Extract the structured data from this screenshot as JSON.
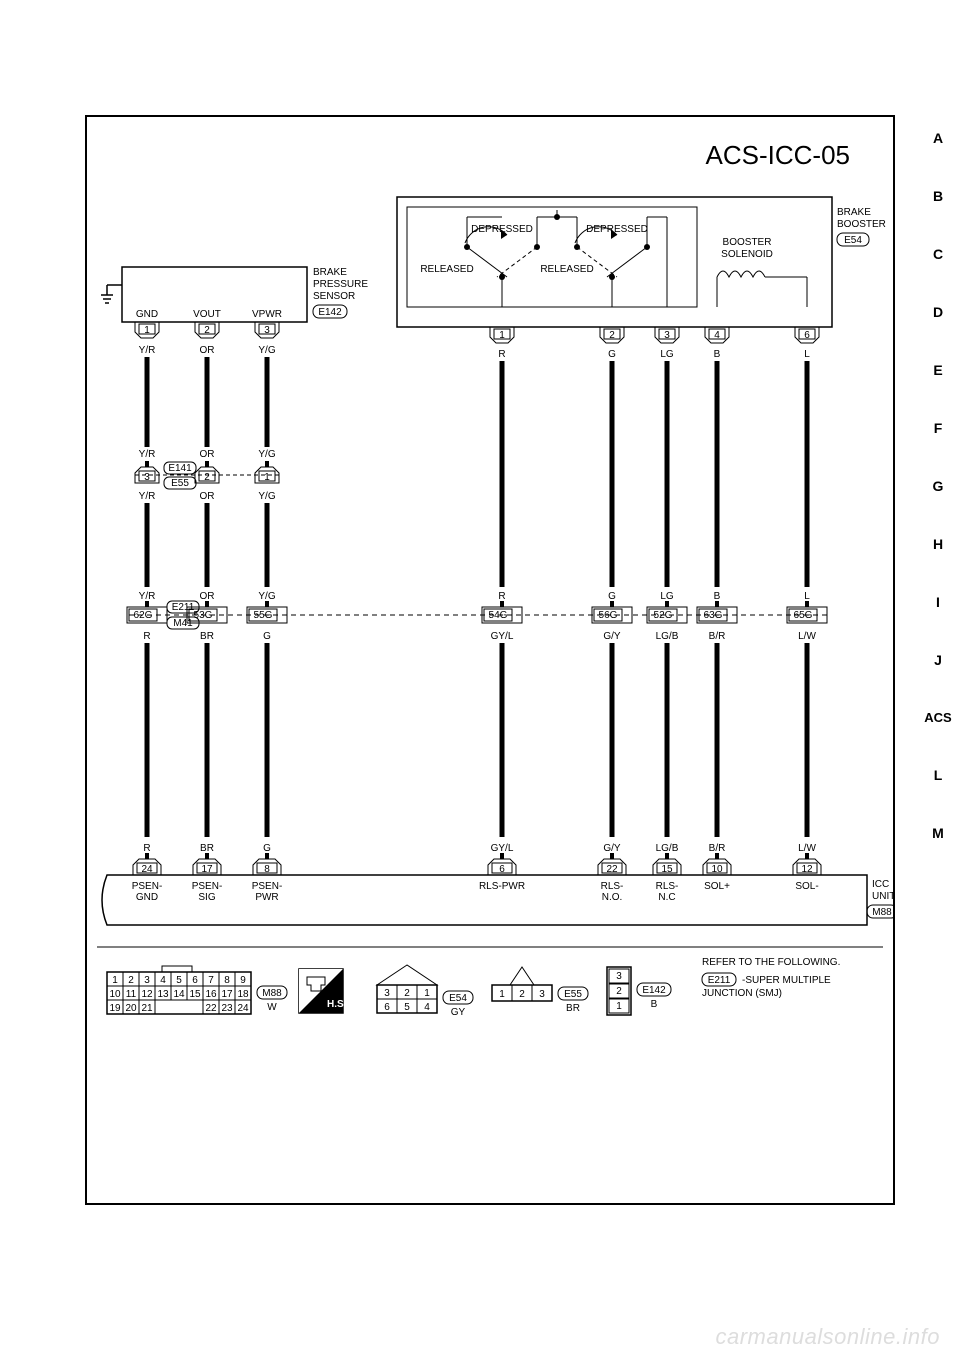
{
  "page_title": "ACS-ICC-05",
  "side_tabs": [
    "A",
    "B",
    "C",
    "D",
    "E",
    "F",
    "G",
    "H",
    "I",
    "J",
    "ACS",
    "L",
    "M"
  ],
  "active_tab": "ACS",
  "components": {
    "brake_pressure_sensor": {
      "label": "BRAKE\nPRESSURE\nSENSOR",
      "connector": "E142",
      "pins": [
        "GND",
        "VOUT",
        "VPWR"
      ]
    },
    "brake_booster": {
      "label": "BRAKE\nBOOSTER",
      "connector": "E54",
      "booster_solenoid": "BOOSTER\nSOLENOID",
      "switch_labels": {
        "depressed": "DEPRESSED",
        "released": "RELEASED"
      }
    },
    "icc_unit": {
      "label": "ICC\nUNIT",
      "connector": "M88"
    }
  },
  "wires": [
    {
      "top_pin": "1",
      "top_color": "Y/R",
      "junction": "62G",
      "junction_conn_top": "E211",
      "junction_conn_bot": "M41",
      "mid_pin": "3",
      "mid_conns": [
        "E141",
        "E55"
      ],
      "mid_color": "Y/R",
      "bottom_color": "R",
      "icc_pin": "24",
      "signal": "PSEN-\nGND"
    },
    {
      "top_pin": "2",
      "top_color": "OR",
      "junction": "53G",
      "mid_pin": "2",
      "mid_color": "OR",
      "bottom_color": "BR",
      "icc_pin": "17",
      "signal": "PSEN-\nSIG"
    },
    {
      "top_pin": "3",
      "top_color": "Y/G",
      "junction": "55G",
      "mid_pin": "1",
      "mid_color": "Y/G",
      "bottom_color": "G",
      "icc_pin": "8",
      "signal": "PSEN-\nPWR"
    },
    {
      "top_pin": "1",
      "top_color": "R",
      "junction": "54G",
      "bottom_color": "GY/L",
      "icc_pin": "6",
      "signal": "RLS-PWR"
    },
    {
      "top_pin": "2",
      "top_color": "G",
      "junction": "56G",
      "bottom_color": "G/Y",
      "icc_pin": "22",
      "signal": "RLS-\nN.O."
    },
    {
      "top_pin": "3",
      "top_color": "LG",
      "junction": "52G",
      "bottom_color": "LG/B",
      "icc_pin": "15",
      "signal": "RLS-\nN.C"
    },
    {
      "top_pin": "4",
      "top_color": "B",
      "junction": "63G",
      "bottom_color": "B/R",
      "icc_pin": "10",
      "signal": "SOL+"
    },
    {
      "top_pin": "6",
      "top_color": "L",
      "junction": "65G",
      "bottom_color": "L/W",
      "icc_pin": "12",
      "signal": "SOL-"
    }
  ],
  "connectors_footer": {
    "m88": {
      "id": "M88",
      "color": "W",
      "pins": [
        [
          "1",
          "2",
          "3",
          "4",
          "5",
          "6",
          "7",
          "8",
          "9"
        ],
        [
          "10",
          "11",
          "12",
          "13",
          "14",
          "15",
          "16",
          "17",
          "18"
        ],
        [
          "19",
          "20",
          "21",
          "",
          "",
          "",
          "22",
          "23",
          "24"
        ]
      ]
    },
    "hs": "H.S.",
    "e54": {
      "id": "E54",
      "color": "GY",
      "pins": [
        [
          "3",
          "2",
          "1"
        ],
        [
          "6",
          "5",
          "4"
        ]
      ]
    },
    "e55": {
      "id": "E55",
      "color": "BR",
      "pins": [
        [
          "1",
          "2",
          "3"
        ]
      ]
    },
    "e142": {
      "id": "E142",
      "color": "B",
      "pins": [
        [
          "3"
        ],
        [
          "2"
        ],
        [
          "1"
        ]
      ]
    }
  },
  "footnote": {
    "text": "REFER TO THE FOLLOWING.",
    "ref": "E211",
    "desc": "-SUPER MULTIPLE\nJUNCTION (SMJ)"
  },
  "watermark": "carmanualsonline.info"
}
